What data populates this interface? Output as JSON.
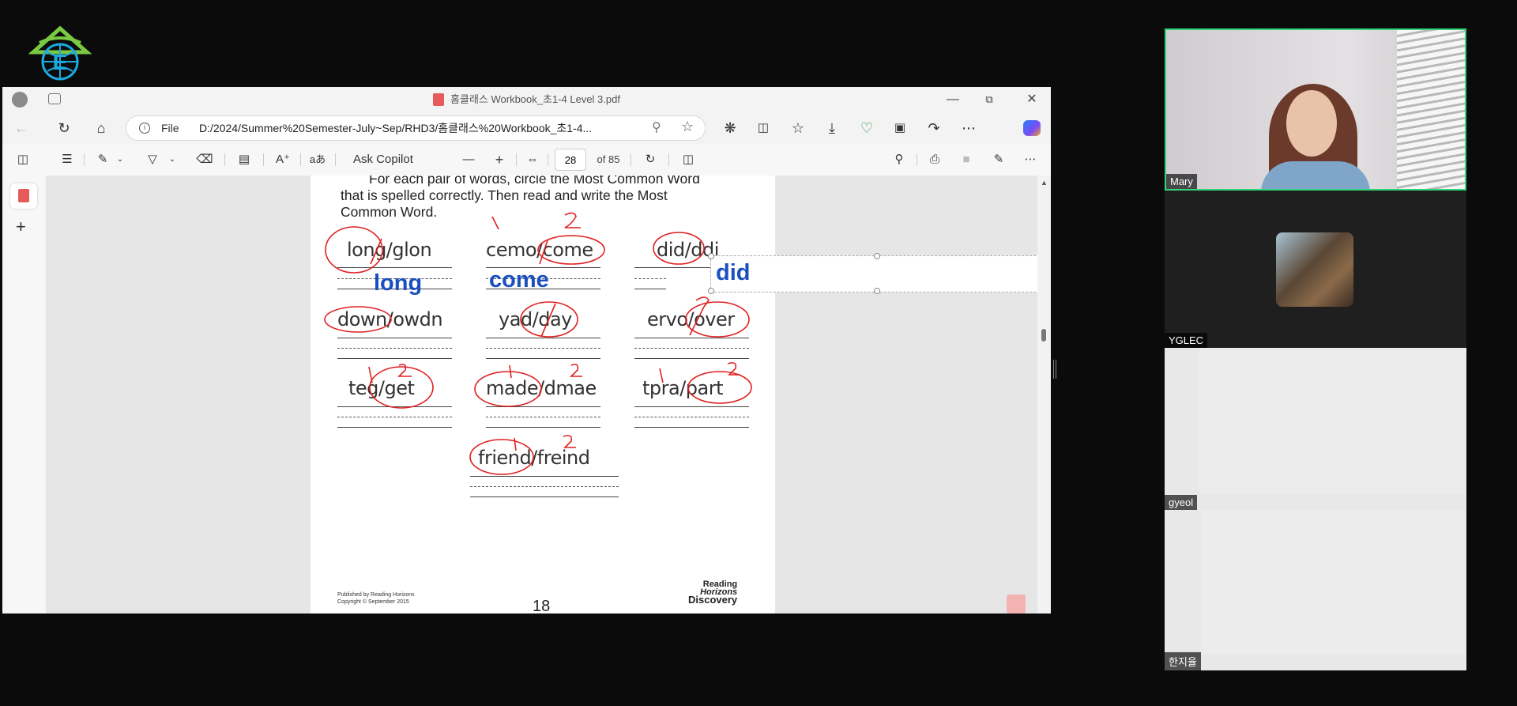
{
  "app": {
    "window_title": "홈클래스 Workbook_초1-4 Level 3.pdf",
    "url_prefix": "File",
    "url": "D:/2024/Summer%20Semester-July~Sep/RHD3/홈클래스%20Workbook_초1-4..."
  },
  "pdf_toolbar": {
    "ask_copilot": "Ask Copilot",
    "current_page": "28",
    "total_pages": "of 85",
    "read_aloud_glyph": "aあ"
  },
  "worksheet": {
    "instructions": [
      "For each pair of words, circle the Most Common Word",
      "that is spelled correctly. Then read and write the Most",
      "Common Word."
    ],
    "pairs": [
      {
        "text": "long/glon",
        "answer": "long"
      },
      {
        "text": "cemo/come",
        "answer": "come"
      },
      {
        "text": "did/ddi",
        "answer": "did"
      },
      {
        "text": "down/owdn",
        "answer": ""
      },
      {
        "text": "yad/day",
        "answer": ""
      },
      {
        "text": "ervo/over",
        "answer": ""
      },
      {
        "text": "teg/get",
        "answer": ""
      },
      {
        "text": "made/dmae",
        "answer": ""
      },
      {
        "text": "tpra/part",
        "answer": ""
      },
      {
        "text": "friend/freind",
        "answer": ""
      }
    ],
    "footer_line1": "Published by Reading Horizons",
    "footer_line2": "Copyright © September 2015",
    "page_number": "18",
    "publisher_logo_lines": [
      "Reading",
      "Horizons",
      "Discovery"
    ]
  },
  "participants": [
    {
      "name": "Mary",
      "active": true
    },
    {
      "name": "YGLEC",
      "active": false
    },
    {
      "name": "gyeol",
      "active": false
    },
    {
      "name": "한지율",
      "active": false
    }
  ],
  "colors": {
    "answer_blue": "#1a4fbf",
    "ink_red": "#e02020",
    "active_speaker_border": "#2fd67a"
  },
  "icons": [
    "profile-icon",
    "tab-actions-icon",
    "pdf-icon",
    "minimize-icon",
    "restore-icon",
    "close-icon",
    "back-icon",
    "refresh-icon",
    "home-icon",
    "info-icon",
    "zoom-icon",
    "favorite-icon",
    "extensions-icon",
    "split-screen-icon",
    "favorites-icon",
    "download-icon",
    "browser-essentials-icon",
    "screenshot-icon",
    "share-icon",
    "more-icon",
    "copilot-icon",
    "contents-icon",
    "highlight-icon",
    "draw-icon",
    "erase-icon",
    "text-icon",
    "read-aloud-icon",
    "translate-icon",
    "zoom-out-icon",
    "zoom-in-icon",
    "fit-page-icon",
    "rotate-icon",
    "page-view-icon",
    "search-icon",
    "print-icon",
    "save-icon",
    "save-as-icon",
    "settings-more-icon",
    "sidebar-toggle-icon",
    "add-icon",
    "pdf-floating-icon"
  ]
}
